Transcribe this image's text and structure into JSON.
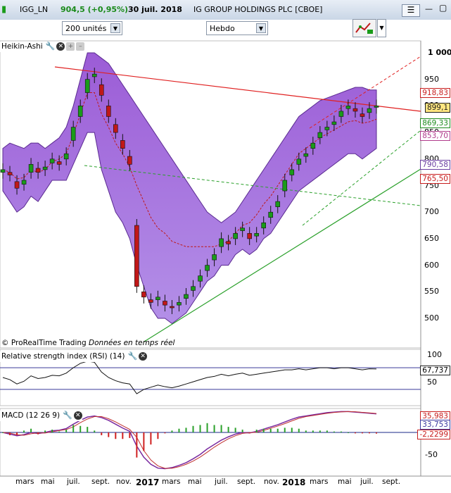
{
  "header": {
    "symbol": "IGG_LN",
    "price": "904,5 (+0,95%)",
    "date": "30 juil. 2018",
    "name": "IG GROUP HOLDINGS PLC [CBOE]"
  },
  "toolbar": {
    "units_select": "200 unités",
    "period_select": "Hebdo"
  },
  "icons": {
    "menu": "hamburger-menu-icon",
    "chart_tools": "chart-tools-icon",
    "settings": "wrench-icon",
    "close": "close-icon"
  },
  "colors": {
    "candle_up": "#1a9b1a",
    "candle_down": "#c01818",
    "band_fill": "#9a5bd6",
    "channel": "#e02020",
    "support": "#2aa02a"
  },
  "credit": {
    "source": "© ProRealTime Trading",
    "note": "Données en temps réel"
  },
  "x_axis": {
    "labels": [
      "mars",
      "mai",
      "juil.",
      "sept.",
      "nov.",
      "2017",
      "mars",
      "mai",
      "juil.",
      "sept.",
      "nov.",
      "2018",
      "mars",
      "mai",
      "juil.",
      "sept."
    ]
  },
  "panels": {
    "price": {
      "title": "Heikin-Ashi",
      "y_ticks": [
        "1 000",
        "950",
        "900",
        "850",
        "800",
        "750",
        "700",
        "650",
        "600",
        "550",
        "500"
      ],
      "tags": [
        {
          "text": "918,83",
          "color": "#c81e1e"
        },
        {
          "text": "899,1",
          "color": "#1e1e1e"
        },
        {
          "text": "869,33",
          "color": "#1e8c1e"
        },
        {
          "text": "853,70",
          "color": "#b03c8c"
        },
        {
          "text": "790,58",
          "color": "#6a3ca0"
        },
        {
          "text": "765,50",
          "color": "#c81e1e"
        }
      ]
    },
    "rsi": {
      "title": "Relative strength index (RSI) (14)",
      "y_ticks": [
        "100",
        "50"
      ],
      "value": "67,737"
    },
    "macd": {
      "title": "MACD (12 26 9)",
      "y_ticks": [
        "-50"
      ],
      "values": [
        "35,983",
        "33,753",
        "-2,2299"
      ]
    }
  },
  "chart_data": [
    {
      "type": "line",
      "title": "IG GROUP HOLDINGS PLC [CBOE]",
      "series": [
        {
          "name": "Heikin-Ashi close",
          "values": [
            780,
            770,
            745,
            760,
            790,
            775,
            785,
            800,
            790,
            810,
            860,
            900,
            950,
            960,
            920,
            880,
            850,
            820,
            790,
            560,
            540,
            530,
            540,
            525,
            520,
            530,
            545,
            560,
            580,
            600,
            620,
            650,
            640,
            660,
            670,
            650,
            660,
            680,
            700,
            720,
            760,
            780,
            800,
            810,
            830,
            850,
            860,
            870,
            890,
            900,
            890,
            880,
            895,
            900
          ]
        },
        {
          "name": "Upper band",
          "values": [
            820,
            830,
            825,
            820,
            830,
            830,
            820,
            830,
            840,
            860,
            900,
            950,
            1000,
            1000,
            990,
            980,
            960,
            940,
            920,
            900,
            880,
            860,
            840,
            820,
            800,
            780,
            760,
            740,
            720,
            700,
            690,
            680,
            690,
            700,
            720,
            740,
            760,
            780,
            800,
            820,
            840,
            860,
            880,
            890,
            900,
            910,
            915,
            920,
            925,
            930,
            935,
            935,
            930,
            930
          ]
        },
        {
          "name": "Lower band",
          "values": [
            740,
            720,
            700,
            710,
            730,
            720,
            740,
            760,
            760,
            760,
            790,
            820,
            850,
            850,
            780,
            740,
            700,
            680,
            650,
            600,
            560,
            520,
            500,
            500,
            490,
            500,
            510,
            530,
            550,
            570,
            580,
            600,
            600,
            620,
            630,
            620,
            630,
            650,
            660,
            680,
            700,
            720,
            740,
            750,
            760,
            770,
            780,
            790,
            800,
            810,
            810,
            800,
            810,
            820
          ]
        },
        {
          "name": "RSI",
          "values": [
            52,
            48,
            40,
            45,
            55,
            50,
            52,
            56,
            55,
            60,
            70,
            78,
            82,
            80,
            62,
            52,
            46,
            42,
            40,
            22,
            30,
            34,
            38,
            35,
            33,
            36,
            40,
            44,
            48,
            52,
            54,
            58,
            55,
            58,
            60,
            56,
            58,
            60,
            62,
            64,
            66,
            66,
            68,
            66,
            68,
            70,
            70,
            68,
            70,
            70,
            68,
            66,
            68,
            67.737
          ]
        },
        {
          "name": "MACD",
          "values": [
            0,
            -3,
            -6,
            -4,
            0,
            -2,
            0,
            3,
            4,
            7,
            15,
            22,
            28,
            30,
            27,
            22,
            15,
            8,
            2,
            -25,
            -45,
            -58,
            -65,
            -66,
            -64,
            -60,
            -55,
            -48,
            -40,
            -30,
            -22,
            -14,
            -8,
            -3,
            0,
            -1,
            2,
            6,
            10,
            14,
            19,
            24,
            28,
            30,
            32,
            34,
            36,
            37,
            38,
            38,
            37,
            36,
            35,
            33.753
          ]
        }
      ],
      "x_range": [
        "2016-02",
        "2018-09"
      ],
      "ylim": [
        470,
        1020
      ]
    }
  ]
}
